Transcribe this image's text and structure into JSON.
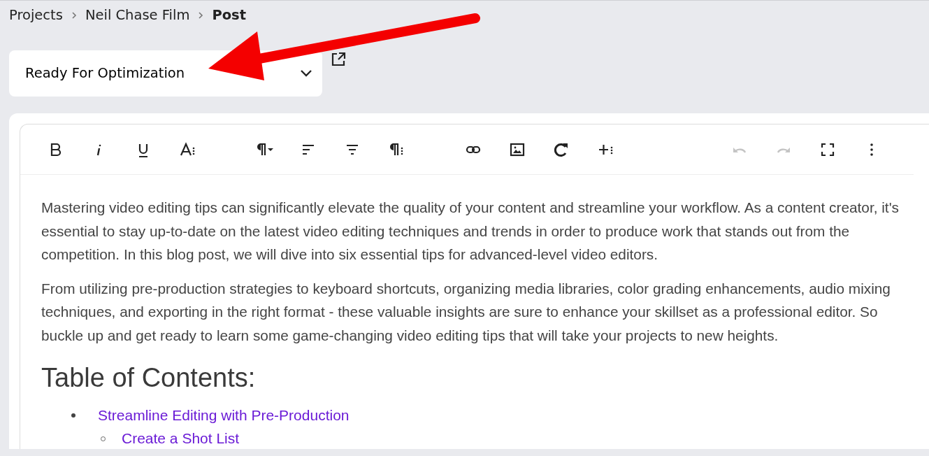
{
  "breadcrumb": [
    {
      "label": "Projects",
      "current": false
    },
    {
      "label": "Neil Chase Film",
      "current": false
    },
    {
      "label": "Post",
      "current": true
    }
  ],
  "status_select": {
    "value": "Ready For Optimization"
  },
  "toolbar": [
    {
      "kind": "bold",
      "disabled": false
    },
    {
      "kind": "italic",
      "disabled": false
    },
    {
      "kind": "underline",
      "disabled": false
    },
    {
      "kind": "text-more",
      "disabled": false
    },
    {
      "kind": "paragraph-format",
      "disabled": false
    },
    {
      "kind": "align-left",
      "disabled": false
    },
    {
      "kind": "align-center",
      "disabled": false
    },
    {
      "kind": "paragraph-more",
      "disabled": false
    },
    {
      "kind": "link",
      "disabled": false
    },
    {
      "kind": "image",
      "disabled": false
    },
    {
      "kind": "refresh",
      "disabled": false
    },
    {
      "kind": "insert-more",
      "disabled": false
    },
    {
      "kind": "undo",
      "disabled": true
    },
    {
      "kind": "redo",
      "disabled": true
    },
    {
      "kind": "fullscreen",
      "disabled": false
    },
    {
      "kind": "more",
      "disabled": false
    }
  ],
  "content": {
    "paragraphs": [
      "Mastering video editing tips can significantly elevate the quality of your content and streamline your workflow. As a content creator, it's essential to stay up-to-date on the latest video editing techniques and trends in order to produce work that stands out from the competition. In this blog post, we will dive into six essential tips for advanced-level video editors.",
      "From utilizing pre-production strategies to keyboard shortcuts, organizing media libraries, color grading enhancements, audio mixing techniques, and exporting in the right format - these valuable insights are sure to enhance your skillset as a professional editor. So buckle up and get ready to learn some game-changing video editing tips that will take your projects to new heights."
    ],
    "heading": "Table of Contents:",
    "toc": [
      {
        "label": "Streamline Editing with Pre-Production",
        "children": [
          {
            "label": "Create a Shot List"
          }
        ]
      }
    ]
  }
}
